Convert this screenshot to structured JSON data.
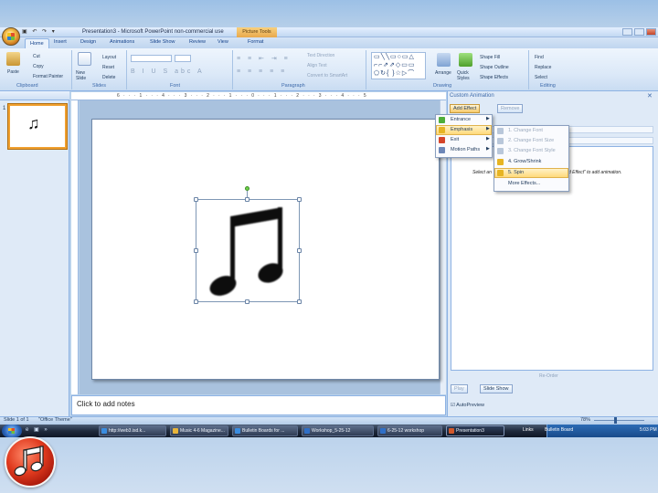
{
  "window": {
    "title": "Presentation3 - Microsoft PowerPoint non-commercial use",
    "context_tab": "Picture Tools"
  },
  "tabs": [
    "Home",
    "Insert",
    "Design",
    "Animations",
    "Slide Show",
    "Review",
    "View",
    "Format"
  ],
  "active_tab": "Home",
  "ribbon": {
    "clipboard": {
      "paste": "Paste",
      "cut": "Cut",
      "copy": "Copy",
      "format_painter": "Format Painter",
      "label": "Clipboard"
    },
    "slides": {
      "new_slide": "New Slide",
      "layout": "Layout",
      "reset": "Reset",
      "delete": "Delete",
      "label": "Slides"
    },
    "font": {
      "label": "Font"
    },
    "paragraph": {
      "text_direction": "Text Direction",
      "align_text": "Align Text",
      "convert_smartart": "Convert to SmartArt",
      "label": "Paragraph"
    },
    "drawing": {
      "arrange": "Arrange",
      "quick_styles": "Quick Styles",
      "shape_fill": "Shape Fill",
      "shape_outline": "Shape Outline",
      "shape_effects": "Shape Effects",
      "label": "Drawing"
    },
    "editing": {
      "find": "Find",
      "replace": "Replace",
      "select": "Select",
      "label": "Editing"
    }
  },
  "slides_pane": {
    "slide_number": "1",
    "thumb_glyph": "♫"
  },
  "ruler": {
    "ticks": "6 · · · 1 · · · 4 · · · 3 · · · 2 · · · 1 · · · 0 · · · 1 · · · 2 · · · 3 · · · 4 · · · 5"
  },
  "notes": {
    "placeholder": "Click to add notes"
  },
  "task_pane": {
    "title": "Custom Animation",
    "add_effect": "Add Effect",
    "remove": "Remove",
    "hint_left": "Select an",
    "hint_right": "d Effect\" to add animation.",
    "reorder": "Re-Order",
    "play": "Play",
    "slide_show": "Slide Show",
    "autopreview": "AutoPreview"
  },
  "add_effect_menu": [
    "Entrance",
    "Emphasis",
    "Exit",
    "Motion Paths"
  ],
  "highlighted_menu_item": "Emphasis",
  "emphasis_submenu": [
    {
      "label": "1. Change Font",
      "enabled": false
    },
    {
      "label": "2. Change Font Size",
      "enabled": false
    },
    {
      "label": "3. Change Font Style",
      "enabled": false
    },
    {
      "label": "4. Grow/Shrink",
      "enabled": true
    },
    {
      "label": "5. Spin",
      "enabled": true
    },
    {
      "label": "More Effects...",
      "enabled": true
    }
  ],
  "highlighted_submenu_item": "5. Spin",
  "status_bar": {
    "slide": "Slide 1 of 1",
    "theme": "\"Office Theme\"",
    "zoom": "78%"
  },
  "taskbar": {
    "items": [
      {
        "label": "http://web3.isd.k...",
        "color": "#3a8de0"
      },
      {
        "label": "Music 4-6 Magazine...",
        "color": "#e8b53a"
      },
      {
        "label": "Bulletin Boards for ...",
        "color": "#3a8de0"
      },
      {
        "label": "Workshop_5-25-12",
        "color": "#2f6fc7"
      },
      {
        "label": "6-25-12 workshop",
        "color": "#2f6fc7"
      },
      {
        "label": "Presentation3",
        "color": "#d2582a"
      }
    ],
    "active_item": "Presentation3",
    "tray": {
      "links": "Links",
      "bulletin": "Bulletin Board",
      "time": "5:03 PM"
    }
  },
  "colors": {
    "ribbon_bg": "#dce9f8",
    "accent_orange": "#f0a030",
    "menu_highlight": "#ffd97a",
    "music_icon_red": "#e03a1e"
  },
  "icons": [
    "office-button-icon",
    "music-note-icon",
    "rotation-handle-icon",
    "music-circle-icon"
  ]
}
